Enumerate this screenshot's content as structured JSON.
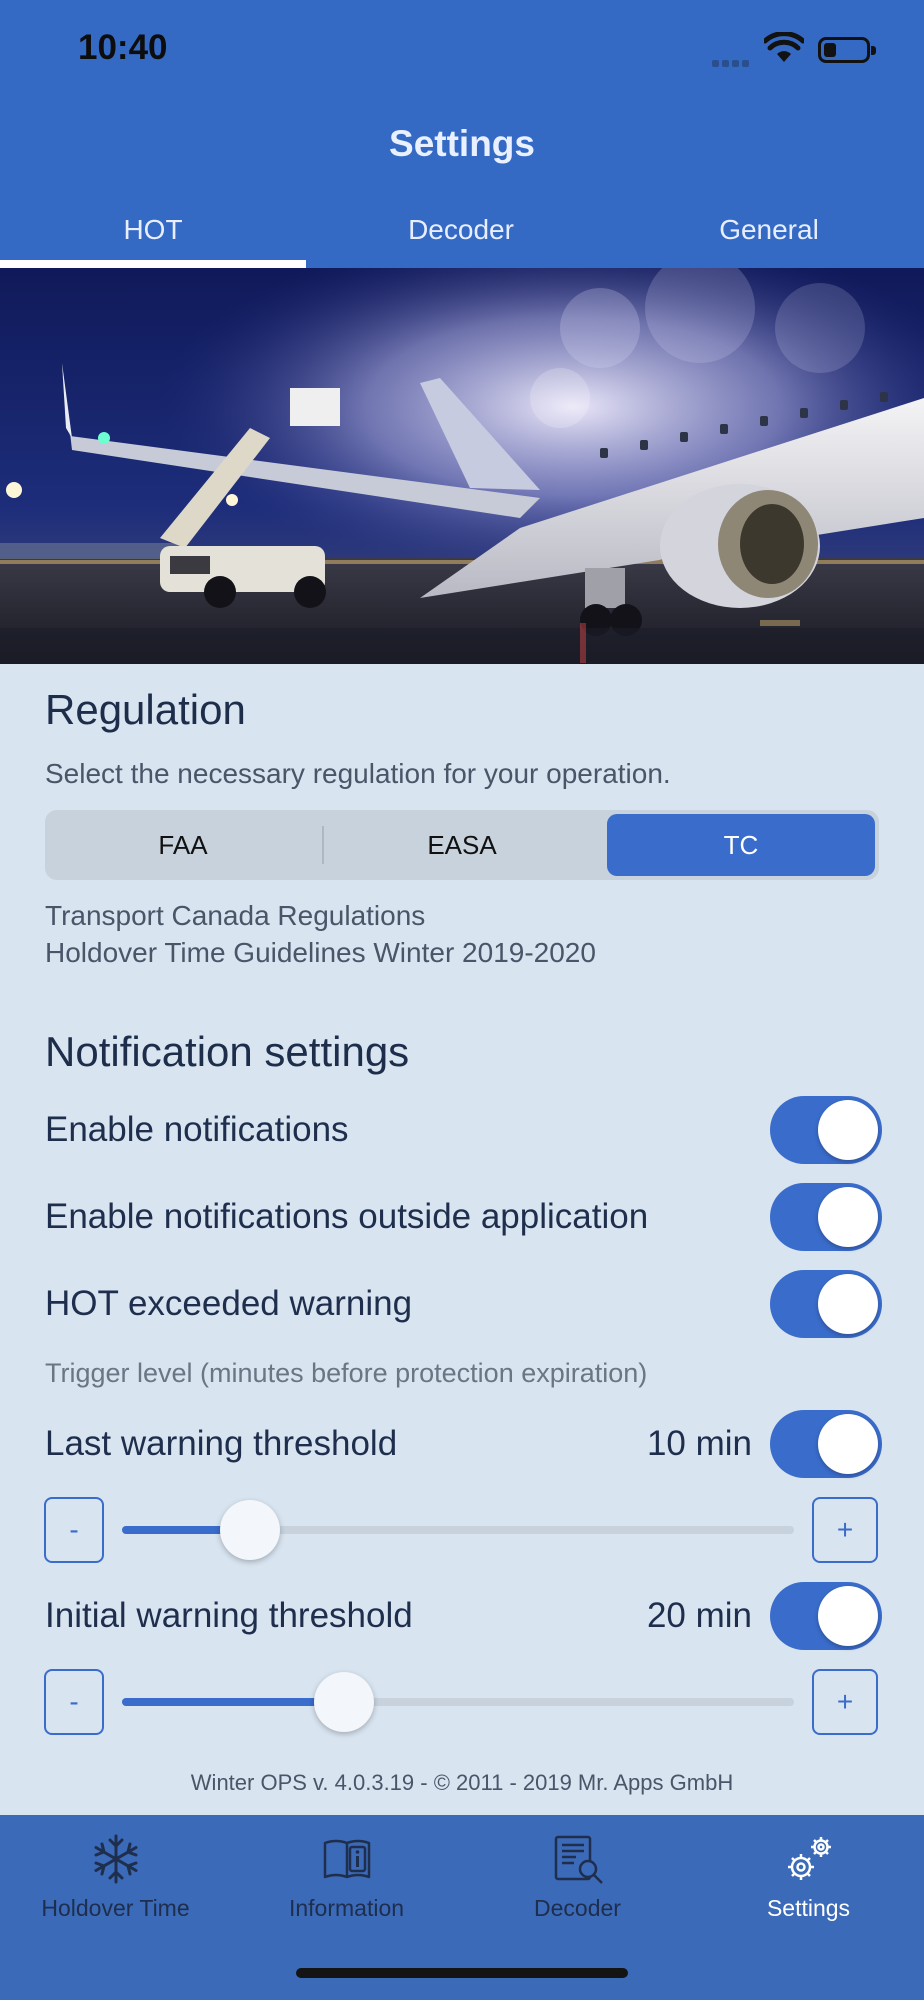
{
  "status_bar": {
    "time": "10:40"
  },
  "nav": {
    "title": "Settings"
  },
  "tabs": [
    {
      "label": "HOT",
      "active": true
    },
    {
      "label": "Decoder",
      "active": false
    },
    {
      "label": "General",
      "active": false
    }
  ],
  "regulation": {
    "title": "Regulation",
    "description": "Select the necessary regulation for your operation.",
    "options": [
      "FAA",
      "EASA",
      "TC"
    ],
    "selected": "TC",
    "detail_line1": "Transport Canada Regulations",
    "detail_line2": "Holdover Time Guidelines Winter 2019-2020"
  },
  "notifications": {
    "title": "Notification settings",
    "enable_label": "Enable notifications",
    "enable_on": true,
    "outside_label": "Enable notifications outside application",
    "outside_on": true,
    "exceeded_label": "HOT exceeded warning",
    "exceeded_on": true,
    "trigger_label": "Trigger level (minutes before protection expiration)",
    "last_label": "Last warning threshold",
    "last_value": "10 min",
    "last_on": true,
    "last_slider_fraction": 0.19,
    "initial_label": "Initial warning threshold",
    "initial_value": "20 min",
    "initial_on": true,
    "initial_slider_fraction": 0.33,
    "minus": "-",
    "plus": "+"
  },
  "footer": {
    "text": "Winter OPS v. 4.0.3.19  -  © 2011 - 2019 Mr. Apps GmbH"
  },
  "tabbar": [
    {
      "label": "Holdover Time",
      "icon": "snowflake-icon",
      "active": false
    },
    {
      "label": "Information",
      "icon": "book-info-icon",
      "active": false
    },
    {
      "label": "Decoder",
      "icon": "document-search-icon",
      "active": false
    },
    {
      "label": "Settings",
      "icon": "gears-icon",
      "active": true
    }
  ],
  "colors": {
    "primary": "#356ac4",
    "background": "#d8e4f0",
    "accent": "#3a6ccb"
  }
}
